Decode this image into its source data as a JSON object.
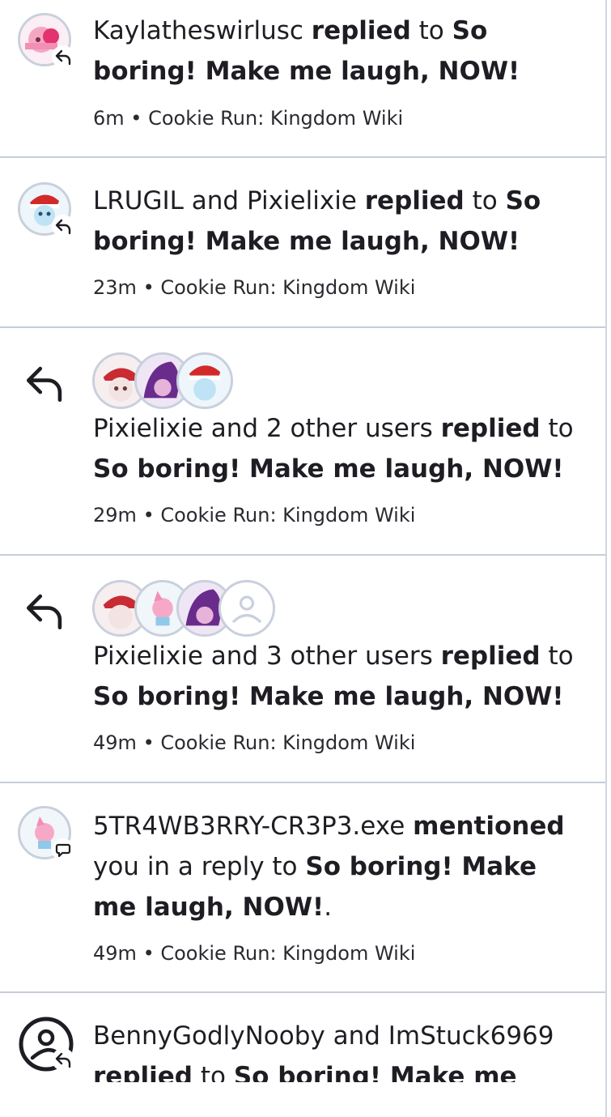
{
  "notifications": [
    {
      "actor": "Kaylatheswirlusc",
      "action": "replied",
      "connector": "to",
      "target": "So boring! Make me laugh, NOW!",
      "time": "6m",
      "wiki": "Cookie Run: Kingdom Wiki"
    },
    {
      "actor": "LRUGIL and Pixielixie",
      "action": "replied",
      "connector": "to",
      "target": "So boring! Make me laugh, NOW!",
      "time": "23m",
      "wiki": "Cookie Run: Kingdom Wiki"
    },
    {
      "actor": "Pixielixie and 2 other users",
      "action": "replied",
      "connector": "to",
      "target": "So boring! Make me laugh, NOW!",
      "time": "29m",
      "wiki": "Cookie Run: Kingdom Wiki"
    },
    {
      "actor": "Pixielixie and 3 other users",
      "action": "replied",
      "connector": "to",
      "target": "So boring! Make me laugh, NOW!",
      "time": "49m",
      "wiki": "Cookie Run: Kingdom Wiki"
    },
    {
      "actor": "5TR4WB3RRY-CR3P3.exe",
      "action": "mentioned",
      "connector": "you in a reply to",
      "target": "So boring! Make me laugh, NOW!",
      "suffix": ".",
      "time": "49m",
      "wiki": "Cookie Run: Kingdom Wiki"
    },
    {
      "actor": "BennyGodlyNooby and ImStuck6969",
      "action": "replied",
      "connector": "to",
      "target": "So boring! Make me laugh,"
    }
  ],
  "separator": "•",
  "icons": {
    "reply": "reply-arrow-icon",
    "mention": "speech-bubble-icon",
    "default_avatar": "user-outline-icon"
  },
  "colors": {
    "accent_bar": "#5b1a55",
    "divider": "#c6cdd8",
    "text": "#1f1d23"
  }
}
